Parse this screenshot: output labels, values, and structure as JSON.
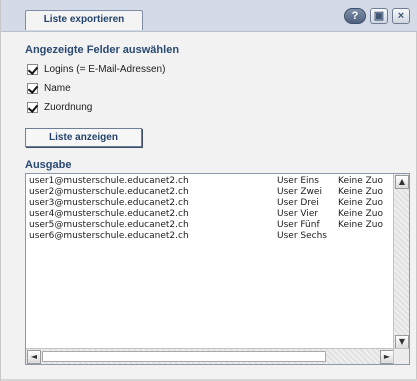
{
  "dialog": {
    "tab_label": "Liste exportieren",
    "window_buttons": {
      "help": "?",
      "restore": "▣",
      "close": "×"
    }
  },
  "fields": {
    "title": "Angezeigte Felder auswählen",
    "items": [
      {
        "label": "Logins (= E-Mail-Adressen)",
        "checked": true
      },
      {
        "label": "Name",
        "checked": true
      },
      {
        "label": "Zuordnung",
        "checked": true
      }
    ]
  },
  "actions": {
    "show_list": "Liste anzeigen"
  },
  "output": {
    "title": "Ausgabe",
    "rows": [
      {
        "email": "user1@musterschule.educanet2.ch",
        "name": "User Eins",
        "assignment": "Keine Zuo"
      },
      {
        "email": "user2@musterschule.educanet2.ch",
        "name": "User Zwei",
        "assignment": "Keine Zuo"
      },
      {
        "email": "user3@musterschule.educanet2.ch",
        "name": "User Drei",
        "assignment": "Keine Zuo"
      },
      {
        "email": "user4@musterschule.educanet2.ch",
        "name": "User Vier",
        "assignment": "Keine Zuo"
      },
      {
        "email": "user5@musterschule.educanet2.ch",
        "name": "User Fünf",
        "assignment": "Keine Zuo"
      },
      {
        "email": "user6@musterschule.educanet2.ch",
        "name": "User Sechs",
        "assignment": ""
      }
    ]
  },
  "scrollbars": {
    "up": "▲",
    "down": "▼",
    "left": "◄",
    "right": "►"
  }
}
